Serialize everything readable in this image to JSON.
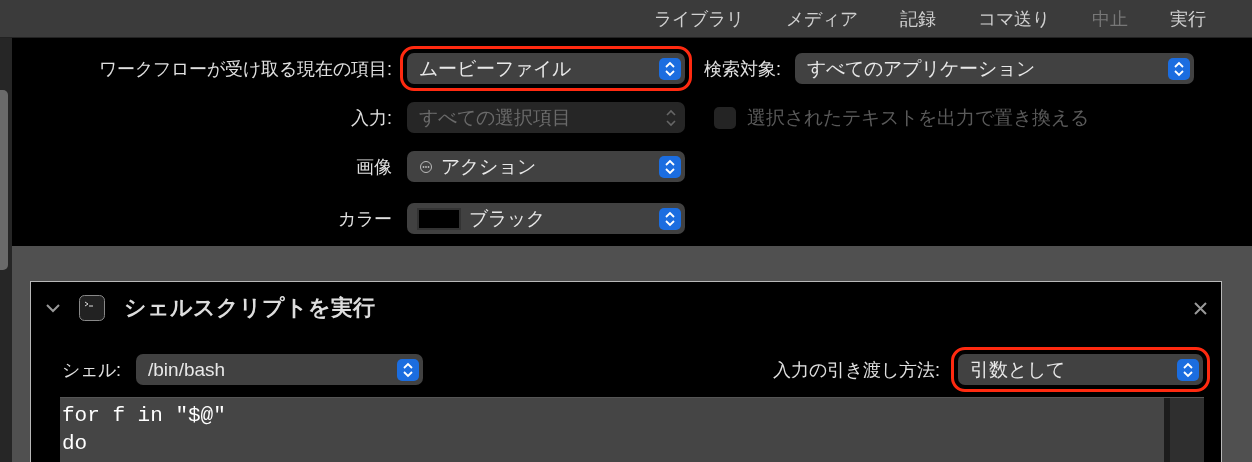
{
  "toolbar": {
    "items": [
      {
        "label": "ライブラリ",
        "disabled": false
      },
      {
        "label": "メディア",
        "disabled": false
      },
      {
        "label": "記録",
        "disabled": false
      },
      {
        "label": "コマ送り",
        "disabled": false
      },
      {
        "label": "中止",
        "disabled": true
      },
      {
        "label": "実行",
        "disabled": false
      }
    ]
  },
  "workflow_input": {
    "label": "ワークフローが受け取る現在の項目:",
    "value": "ムービーファイル",
    "highlighted": true
  },
  "search_target": {
    "label": "検索対象:",
    "value": "すべてのアプリケーション"
  },
  "input": {
    "label": "入力:",
    "value": "すべての選択項目",
    "disabled": true
  },
  "replace_checkbox": {
    "label": "選択されたテキストを出力で置き換える",
    "checked": false,
    "disabled": true
  },
  "image": {
    "label": "画像",
    "value": "アクション"
  },
  "color": {
    "label": "カラー",
    "value": "ブラック"
  },
  "action": {
    "title": "シェルスクリプトを実行",
    "expanded": true,
    "shell": {
      "label": "シェル:",
      "value": "/bin/bash"
    },
    "pass_input": {
      "label": "入力の引き渡し方法:",
      "value": "引数として",
      "highlighted": true
    },
    "script_lines": [
      "for f in \"$@\"",
      "do"
    ]
  }
}
